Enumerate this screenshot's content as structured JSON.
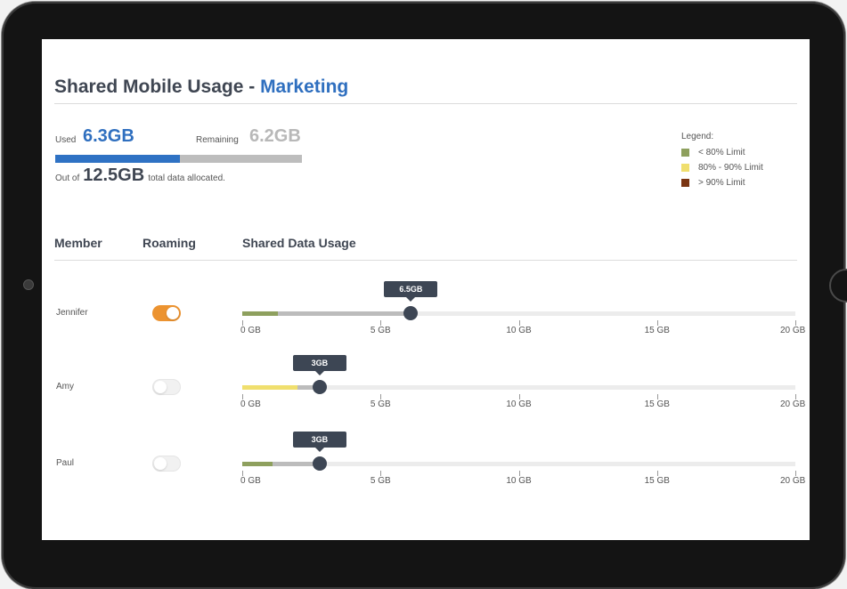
{
  "header": {
    "title_prefix": "Shared Mobile Usage - ",
    "title_department": "Marketing"
  },
  "usage": {
    "used_label": "Used",
    "used_value": "6.3GB",
    "remaining_label": "Remaining",
    "remaining_value": "6.2GB",
    "used_fraction": 0.504,
    "outof_prefix": "Out of",
    "total_value": "12.5GB",
    "outof_suffix": "total data allocated."
  },
  "legend": {
    "title": "Legend:",
    "items": [
      {
        "label": "< 80% Limit",
        "color": "#8ea05e"
      },
      {
        "label": "80% - 90% Limit",
        "color": "#f0df6e"
      },
      {
        "label": "> 90% Limit",
        "color": "#7a3512"
      }
    ]
  },
  "table": {
    "col_member": "Member",
    "col_roaming": "Roaming",
    "col_usage": "Shared Data Usage"
  },
  "scale": {
    "max_gb": 20,
    "ticks": [
      0,
      5,
      10,
      15,
      20
    ],
    "tick_labels": [
      "0 GB",
      "5 GB",
      "10 GB",
      "15 GB",
      "20 GB"
    ]
  },
  "members": [
    {
      "name": "Jennifer",
      "roaming": true,
      "usage_gb": 6.1,
      "usage_label": "6.5GB",
      "color_fill_gb": 1.3,
      "fill_color": "#8ea05e"
    },
    {
      "name": "Amy",
      "roaming": false,
      "usage_gb": 2.8,
      "usage_label": "3GB",
      "color_fill_gb": 2.0,
      "fill_color": "#f0df6e"
    },
    {
      "name": "Paul",
      "roaming": false,
      "usage_gb": 2.8,
      "usage_label": "3GB",
      "color_fill_gb": 1.1,
      "fill_color": "#8ea05e"
    }
  ]
}
